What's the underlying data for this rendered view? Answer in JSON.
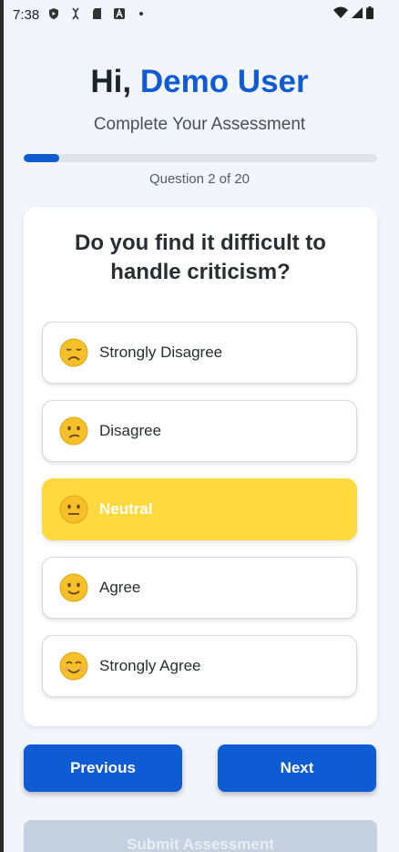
{
  "status_bar": {
    "time": "7:38"
  },
  "header": {
    "greeting_prefix": "Hi,",
    "user_name": "Demo User",
    "subtitle": "Complete Your Assessment"
  },
  "progress": {
    "current": 2,
    "total": 20,
    "fraction": 0.1,
    "label": "Question 2 of 20"
  },
  "question": {
    "text": "Do you find it difficult to handle criticism?"
  },
  "options": [
    {
      "label": "Strongly Disagree",
      "icon": "sad-face-icon",
      "selected": false
    },
    {
      "label": "Disagree",
      "icon": "confused-face-icon",
      "selected": false
    },
    {
      "label": "Neutral",
      "icon": "neutral-face-icon",
      "selected": true
    },
    {
      "label": "Agree",
      "icon": "slight-smile-face-icon",
      "selected": false
    },
    {
      "label": "Strongly Agree",
      "icon": "smiling-face-icon",
      "selected": false
    }
  ],
  "buttons": {
    "previous": "Previous",
    "next": "Next",
    "submit": "Submit Assessment"
  },
  "colors": {
    "accent": "#0e5bd3",
    "selected": "#ffd93d",
    "background": "#f2f5fc"
  }
}
